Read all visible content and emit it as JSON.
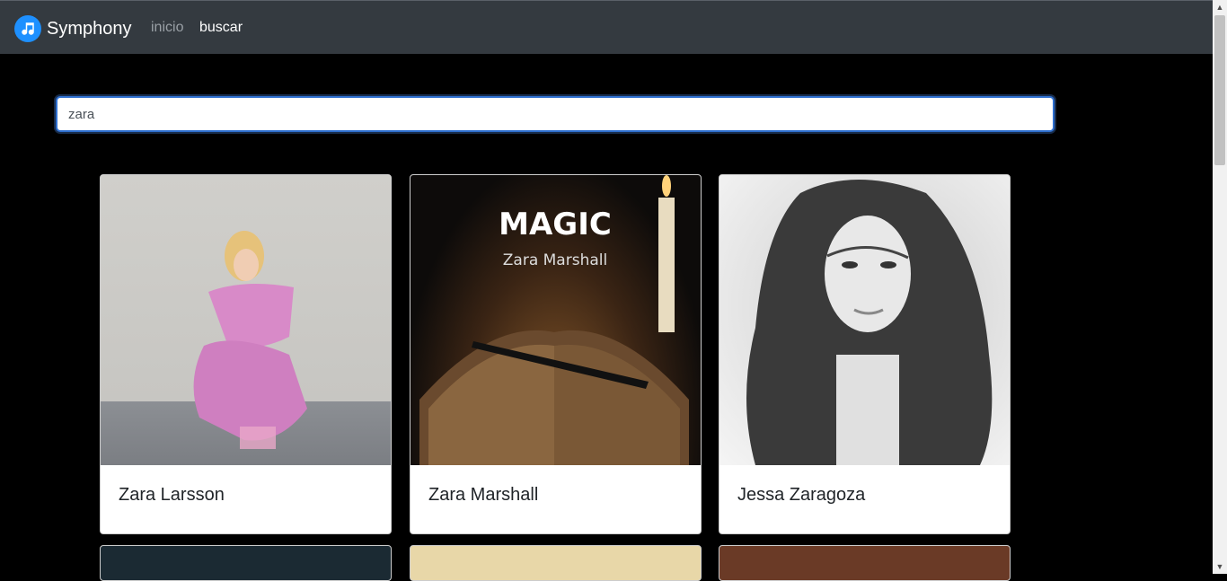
{
  "navbar": {
    "brand_name": "Symphony",
    "links": [
      {
        "label": "inicio"
      },
      {
        "label": "buscar"
      }
    ]
  },
  "search": {
    "value": "zara",
    "placeholder": ""
  },
  "results": [
    {
      "name": "Zara Larsson"
    },
    {
      "name": "Zara Marshall",
      "image_text": {
        "title": "MAGIC",
        "subtitle": "Zara Marshall"
      }
    },
    {
      "name": "Jessa Zaragoza"
    }
  ],
  "colors": {
    "navbar_bg": "#343a40",
    "page_bg": "#000000",
    "accent": "#1e90ff"
  },
  "icons": {
    "brand": "music-note-icon"
  }
}
